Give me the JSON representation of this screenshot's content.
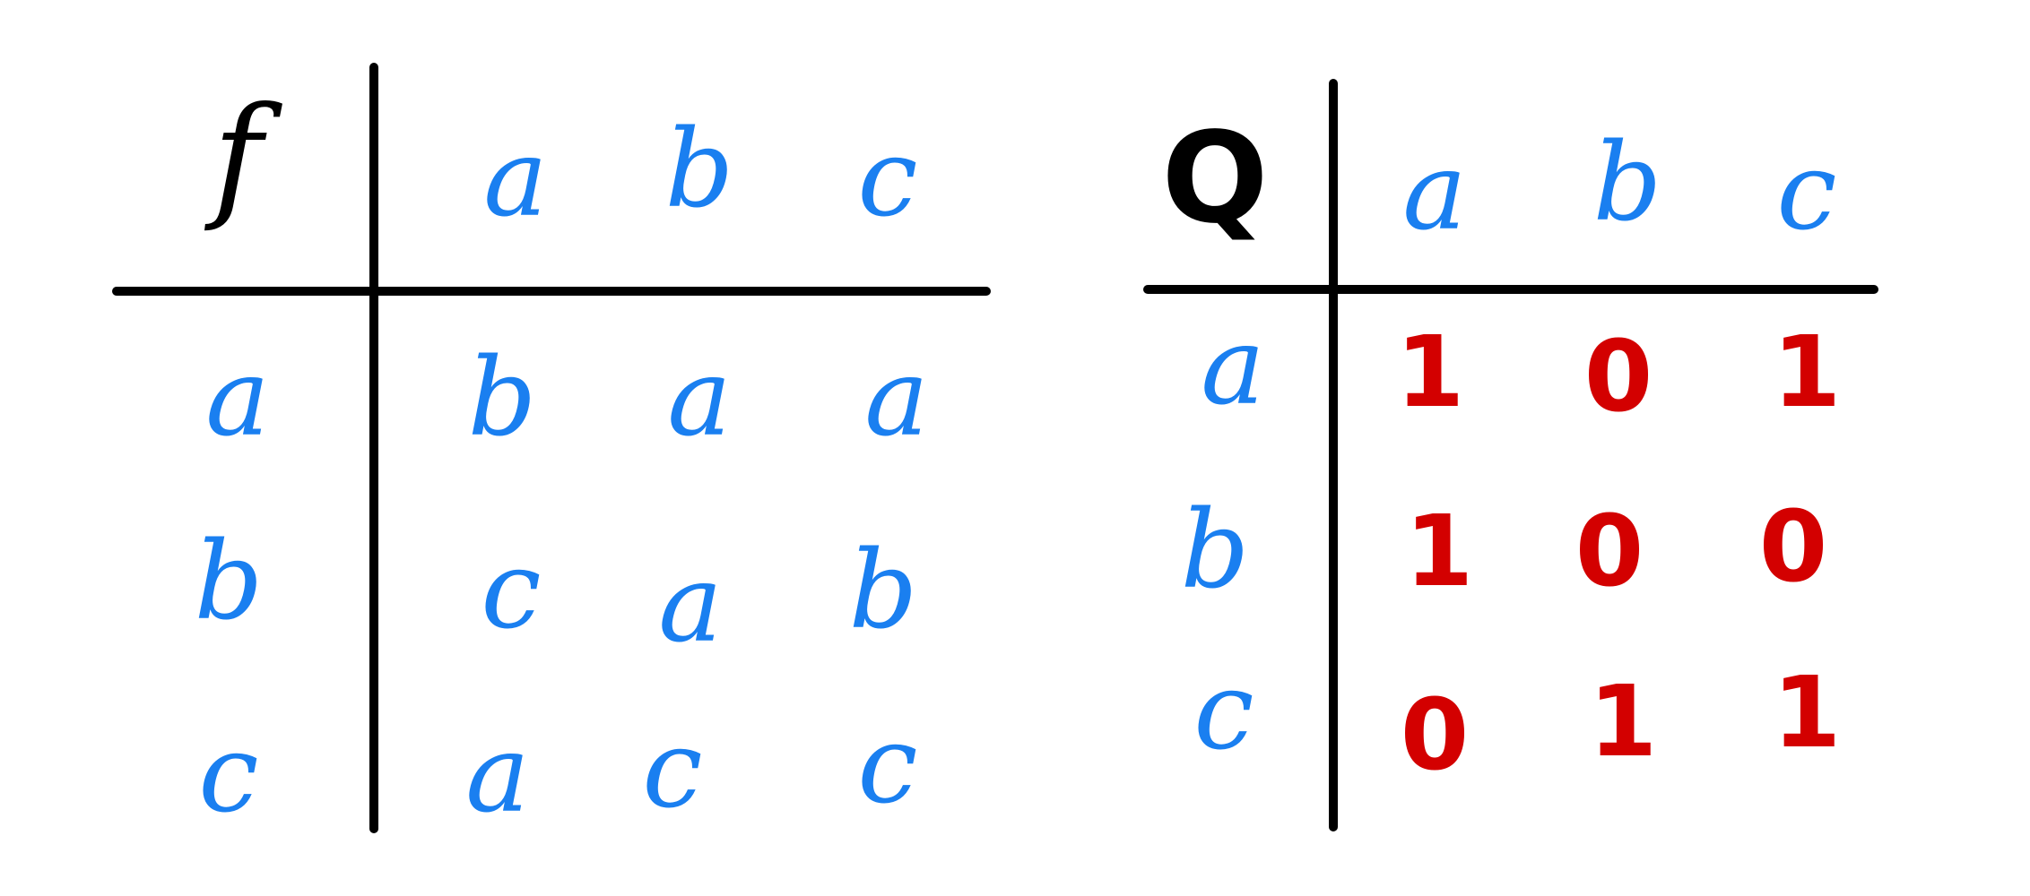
{
  "colors": {
    "ink": "#000000",
    "elements": "#1a7ff0",
    "values": "#d30000",
    "background": "#ffffff"
  },
  "table_f": {
    "operator": "f",
    "col_headers": [
      "a",
      "b",
      "c"
    ],
    "rows": [
      {
        "header": "a",
        "cells": [
          "b",
          "a",
          "a"
        ]
      },
      {
        "header": "b",
        "cells": [
          "c",
          "a",
          "b"
        ]
      },
      {
        "header": "c",
        "cells": [
          "a",
          "c",
          "c"
        ]
      }
    ]
  },
  "table_q": {
    "operator": "Q",
    "col_headers": [
      "a",
      "b",
      "c"
    ],
    "rows": [
      {
        "header": "a",
        "cells": [
          "1",
          "0",
          "1"
        ]
      },
      {
        "header": "b",
        "cells": [
          "1",
          "0",
          "0"
        ]
      },
      {
        "header": "c",
        "cells": [
          "0",
          "1",
          "1"
        ]
      }
    ]
  }
}
